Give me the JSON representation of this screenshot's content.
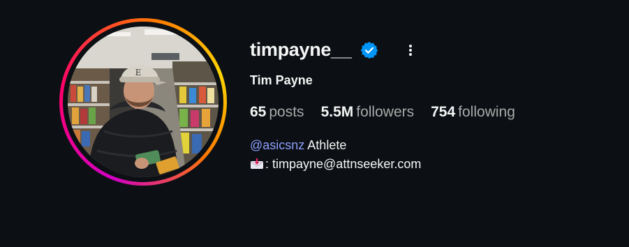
{
  "profile": {
    "username": "timpayne__",
    "full_name": "Tim Payne",
    "verified": true,
    "verified_icon": "verified-badge-icon",
    "options_icon": "more-options-icon",
    "stats": {
      "posts_count": "65",
      "posts_label": "posts",
      "followers_count": "5.5M",
      "followers_label": "followers",
      "following_count": "754",
      "following_label": "following"
    },
    "bio": {
      "mention": "@asicsnz",
      "line1_text": " Athlete",
      "line2_icon": "envelope-with-arrow-icon",
      "line2_text": ": timpayne@attnseeker.com"
    }
  },
  "colors": {
    "background": "#0c1014",
    "text_primary": "#f5f5f5",
    "text_secondary": "#a8a8a8",
    "mention_link": "#8c9fff",
    "verified_blue": "#0095f6",
    "story_ring": [
      "#d300c5",
      "#ff0069",
      "#ff7a00",
      "#ffd600"
    ]
  }
}
